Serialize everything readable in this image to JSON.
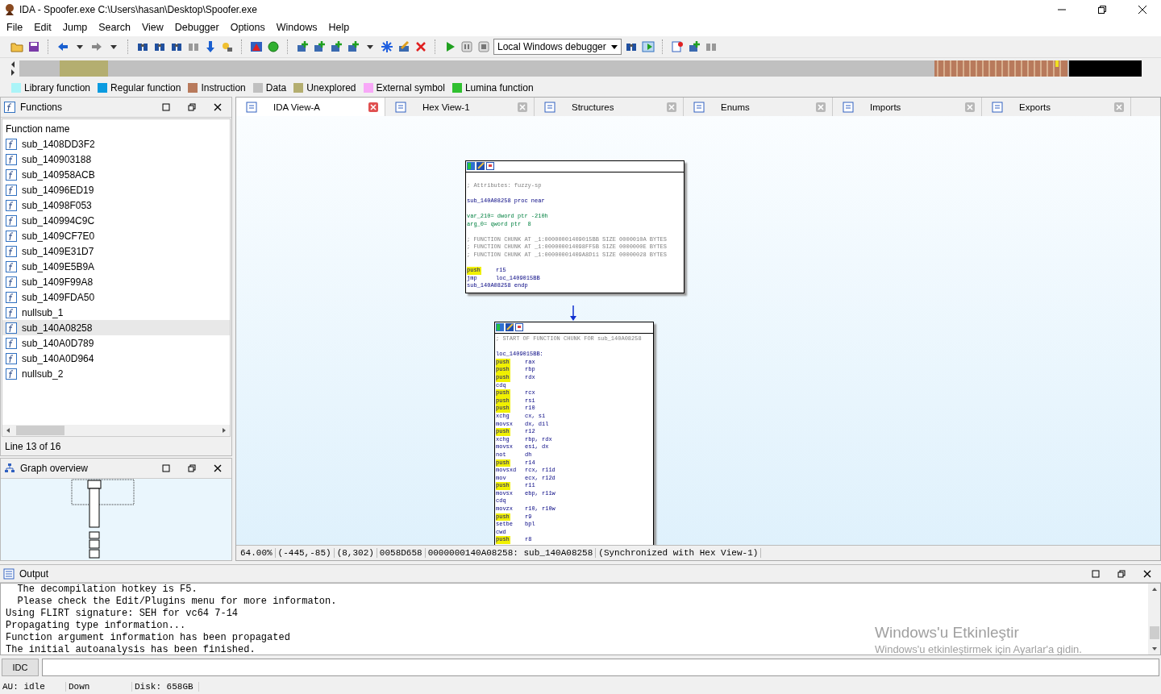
{
  "window": {
    "title": "IDA - Spoofer.exe C:\\Users\\hasan\\Desktop\\Spoofer.exe"
  },
  "menu": [
    "File",
    "Edit",
    "Jump",
    "Search",
    "View",
    "Debugger",
    "Options",
    "Windows",
    "Help"
  ],
  "toolbar": {
    "debugger_select": "Local Windows debugger"
  },
  "legend": [
    {
      "label": "Library function",
      "color": "#aaf4f8"
    },
    {
      "label": "Regular function",
      "color": "#0a9be0"
    },
    {
      "label": "Instruction",
      "color": "#b87a5c"
    },
    {
      "label": "Data",
      "color": "#c0c0c0"
    },
    {
      "label": "Unexplored",
      "color": "#b4ae70"
    },
    {
      "label": "External symbol",
      "color": "#f8a8f8"
    },
    {
      "label": "Lumina function",
      "color": "#30c030"
    }
  ],
  "functions_panel": {
    "title": "Functions",
    "column": "Function name",
    "status": "Line 13 of 16",
    "items": [
      {
        "name": "sub_1408DD3F2",
        "selected": false
      },
      {
        "name": "sub_140903188",
        "selected": false
      },
      {
        "name": "sub_140958ACB",
        "selected": false
      },
      {
        "name": "sub_14096ED19",
        "selected": false
      },
      {
        "name": "sub_14098F053",
        "selected": false
      },
      {
        "name": "sub_140994C9C",
        "selected": false
      },
      {
        "name": "sub_1409CF7E0",
        "selected": false
      },
      {
        "name": "sub_1409E31D7",
        "selected": false
      },
      {
        "name": "sub_1409E5B9A",
        "selected": false
      },
      {
        "name": "sub_1409F99A8",
        "selected": false
      },
      {
        "name": "sub_1409FDA50",
        "selected": false
      },
      {
        "name": "nullsub_1",
        "selected": false
      },
      {
        "name": "sub_140A08258",
        "selected": true
      },
      {
        "name": "sub_140A0D789",
        "selected": false
      },
      {
        "name": "sub_140A0D964",
        "selected": false
      },
      {
        "name": "nullsub_2",
        "selected": false
      }
    ]
  },
  "graph_overview": {
    "title": "Graph overview"
  },
  "tabs": [
    {
      "label": "IDA View-A",
      "selected": true
    },
    {
      "label": "Hex View-1",
      "selected": false
    },
    {
      "label": "Structures",
      "selected": false
    },
    {
      "label": "Enums",
      "selected": false
    },
    {
      "label": "Imports",
      "selected": false
    },
    {
      "label": "Exports",
      "selected": false
    }
  ],
  "graph": {
    "nodes": [
      {
        "lines": [
          {
            "kind": "blank"
          },
          {
            "kind": "comment",
            "text": "; Attributes: fuzzy-sp"
          },
          {
            "kind": "blank"
          },
          {
            "kind": "label",
            "text": "sub_140A08258 proc near"
          },
          {
            "kind": "blank"
          },
          {
            "kind": "var",
            "text": "var_210= dword ptr -210h"
          },
          {
            "kind": "var",
            "text": "arg_0= qword ptr  8"
          },
          {
            "kind": "blank"
          },
          {
            "kind": "comment",
            "text": "; FUNCTION CHUNK AT _1:00000001409015BB SIZE 0000010A BYTES"
          },
          {
            "kind": "comment",
            "text": "; FUNCTION CHUNK AT _1:000000014098FF5B SIZE 0000000E BYTES"
          },
          {
            "kind": "comment",
            "text": "; FUNCTION CHUNK AT _1:00000001409A8D11 SIZE 00000028 BYTES"
          },
          {
            "kind": "blank"
          },
          {
            "kind": "instr",
            "op": "push",
            "args": "r15",
            "highlighted": true
          },
          {
            "kind": "instr",
            "op": "jmp",
            "args": "loc_1409015BB",
            "highlighted": false
          },
          {
            "kind": "label",
            "text": "sub_140A08258 endp"
          }
        ]
      },
      {
        "lines": [
          {
            "kind": "comment",
            "text": "; START OF FUNCTION CHUNK FOR sub_140A08258"
          },
          {
            "kind": "blank"
          },
          {
            "kind": "label",
            "text": "loc_1409015BB:"
          },
          {
            "kind": "instr",
            "op": "push",
            "args": "rax",
            "highlighted": true
          },
          {
            "kind": "instr",
            "op": "push",
            "args": "rbp",
            "highlighted": true
          },
          {
            "kind": "instr",
            "op": "push",
            "args": "rdx",
            "highlighted": true
          },
          {
            "kind": "instr",
            "op": "cdq",
            "highlighted": false
          },
          {
            "kind": "instr",
            "op": "push",
            "args": "rcx",
            "highlighted": true
          },
          {
            "kind": "instr",
            "op": "push",
            "args": "rsi",
            "highlighted": true
          },
          {
            "kind": "instr",
            "op": "push",
            "args": "r10",
            "highlighted": true
          },
          {
            "kind": "instr",
            "op": "xchg",
            "args": "cx, si",
            "highlighted": false
          },
          {
            "kind": "instr",
            "op": "movsx",
            "args": "dx, dil",
            "highlighted": false
          },
          {
            "kind": "instr",
            "op": "push",
            "args": "r12",
            "highlighted": true
          },
          {
            "kind": "instr",
            "op": "xchg",
            "args": "rbp, rdx",
            "highlighted": false
          },
          {
            "kind": "instr",
            "op": "movsx",
            "args": "esi, dx",
            "highlighted": false
          },
          {
            "kind": "instr",
            "op": "not",
            "args": "dh",
            "highlighted": false
          },
          {
            "kind": "instr",
            "op": "push",
            "args": "r14",
            "highlighted": true
          },
          {
            "kind": "instr",
            "op": "movsxd",
            "args": "rcx, r11d",
            "highlighted": false
          },
          {
            "kind": "instr",
            "op": "mov",
            "args": "ecx, r12d",
            "highlighted": false
          },
          {
            "kind": "instr",
            "op": "push",
            "args": "r11",
            "highlighted": true
          },
          {
            "kind": "instr",
            "op": "movsx",
            "args": "ebp, r11w",
            "highlighted": false
          },
          {
            "kind": "instr",
            "op": "cdq",
            "highlighted": false
          },
          {
            "kind": "instr",
            "op": "movzx",
            "args": "r10, r10w",
            "highlighted": false
          },
          {
            "kind": "instr",
            "op": "push",
            "args": "r9",
            "highlighted": true
          },
          {
            "kind": "instr",
            "op": "setbe",
            "args": "bpl",
            "highlighted": false
          },
          {
            "kind": "instr",
            "op": "cwd",
            "highlighted": false
          },
          {
            "kind": "instr",
            "op": "push",
            "args": "r8",
            "highlighted": true
          }
        ]
      }
    ],
    "status": [
      "64.00%",
      "(-445,-85)",
      "(8,302)",
      "0058D658",
      "0000000140A08258: sub_140A08258",
      "(Synchronized with Hex View-1)"
    ]
  },
  "output": {
    "title": "Output",
    "lines": [
      "  The decompilation hotkey is F5.",
      "  Please check the Edit/Plugins menu for more informaton.",
      "Using FLIRT signature: SEH for vc64 7-14",
      "Propagating type information...",
      "Function argument information has been propagated",
      "The initial autoanalysis has been finished."
    ],
    "command_button": "IDC"
  },
  "status_bar": [
    "AU:  idle",
    "Down",
    "Disk: 658GB"
  ],
  "activation_notice": {
    "title": "Windows'u Etkinleştir",
    "text": "Windows'u etkinleştirmek için Ayarlar'a gidin."
  }
}
